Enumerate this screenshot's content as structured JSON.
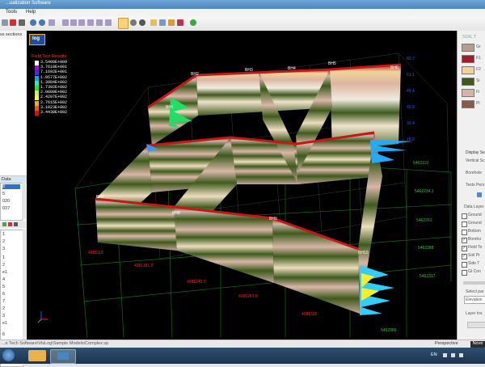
{
  "window": {
    "title": "...ualization Software"
  },
  "menu": [
    "Tools",
    "Help"
  ],
  "left_panel": {
    "top_label": "ss sections",
    "section_label": "Data",
    "list_items": [
      "8",
      "5",
      "020",
      "037"
    ],
    "tree_items": [
      "1",
      "2",
      "3",
      "1",
      "2",
      "e1",
      "4",
      "5",
      "6",
      "7",
      "2",
      "3",
      "e1",
      "6",
      "e5",
      "5"
    ]
  },
  "viewport": {
    "legend": {
      "title": "Field Test Results",
      "entries": [
        {
          "value": "3.5400E+000",
          "color": "#ffffff"
        },
        {
          "value": "3.7610E+001",
          "color": "#aa00ff"
        },
        {
          "value": "7.1692E+001",
          "color": "#3333ff"
        },
        {
          "value": "1.0577E+002",
          "color": "#00aaff"
        },
        {
          "value": "1.3984E+002",
          "color": "#00ffcc"
        },
        {
          "value": "1.7392E+002",
          "color": "#00ff00"
        },
        {
          "value": "2.0800E+002",
          "color": "#ccff00"
        },
        {
          "value": "2.4207E+002",
          "color": "#ffff00"
        },
        {
          "value": "2.7615E+002",
          "color": "#ffaa00"
        },
        {
          "value": "3.1023E+002",
          "color": "#ff5500"
        },
        {
          "value": "3.4430E+002",
          "color": "#ff0000"
        }
      ]
    },
    "boreholes": [
      "BH1",
      "BH2",
      "BH3",
      "BH4",
      "BH5",
      "BH6",
      "BH7",
      "BH8",
      "BH9",
      "BH10",
      "BH11",
      "BH12"
    ],
    "axis_x_labels": [
      "4981118",
      "4981181.2",
      "4981241.5",
      "4981281.8",
      "4981502"
    ],
    "axis_y_labels": [
      "5462110",
      "5462234.1",
      "5462261",
      "5462288",
      "5462317",
      "5462389"
    ],
    "axis_z_labels": [
      "80.7",
      "61.1",
      "49.4",
      "40.9",
      "30.4",
      "18.9"
    ],
    "logo_text": "log"
  },
  "right_panel": {
    "header": "SOIL T",
    "soil_colors": [
      "#b79d8c",
      "#a01c28",
      "#efd39a",
      "#3f5a1d",
      "#d7b4a5",
      "#8a5a4a"
    ],
    "soil_labels": [
      "Gr",
      "F1",
      "F2",
      "Si",
      "Fi",
      "Pl"
    ],
    "display_header": "Display Se",
    "vertical_label": "Vertical Sc",
    "borehole_label": "Borehole",
    "tests_label": "Tests Pers",
    "data_layers_label": "Data Layer",
    "layers": [
      {
        "label": "Ground",
        "checked": false
      },
      {
        "label": "Ground",
        "checked": false
      },
      {
        "label": "Bottom",
        "checked": false
      },
      {
        "label": "Boreho",
        "checked": true
      },
      {
        "label": "Field Te",
        "checked": true
      },
      {
        "label": "Soil Pr",
        "checked": true
      },
      {
        "label": "Side T",
        "checked": false
      },
      {
        "label": "GI Con",
        "checked": false
      }
    ],
    "select_label": "Select par",
    "select_value": "Elevation",
    "layer_label": "Layer Ins"
  },
  "status": {
    "path": "...e Tech Software\\VisLog\\Sample Models\\Complex.vp",
    "mode": "Perspective",
    "extra": "Nove"
  },
  "taskbar": {
    "lang": "EN"
  }
}
